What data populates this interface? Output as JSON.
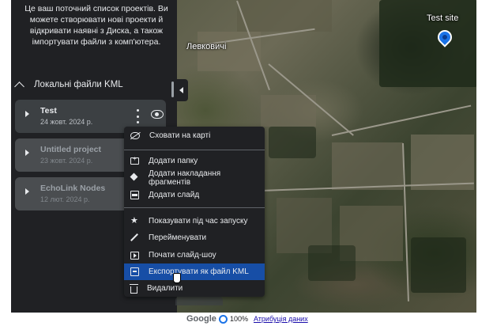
{
  "map": {
    "labels": {
      "village": "Левковичі",
      "site": "Test site"
    }
  },
  "panel": {
    "intro": "Це ваш поточний список проектів. Ви можете створювати нові проекти й відкривати наявні з Диска, а також імпортувати файли з комп'ютера.",
    "section_title": "Локальні файли KML",
    "projects": [
      {
        "name": "Test",
        "date": "24 жовт. 2024 р."
      },
      {
        "name": "Untitled project",
        "date": "23 жовт. 2024 р."
      },
      {
        "name": "EchoLink Nodes",
        "date": "12 лют. 2024 р."
      }
    ]
  },
  "context_menu": {
    "items": [
      {
        "label": "Сховати на карті",
        "icon": "eye-off-icon"
      },
      {
        "label": "Додати папку",
        "icon": "folder-add-icon"
      },
      {
        "label": "Додати накладання фрагментів",
        "icon": "layers-icon"
      },
      {
        "label": "Додати слайд",
        "icon": "slide-icon"
      },
      {
        "label": "Показувати під час запуску",
        "icon": "star-icon"
      },
      {
        "label": "Перейменувати",
        "icon": "pencil-icon"
      },
      {
        "label": "Почати слайд-шоу",
        "icon": "slideshow-icon"
      },
      {
        "label": "Експортувати як файл KML",
        "icon": "export-icon"
      },
      {
        "label": "Видалити",
        "icon": "trash-icon"
      }
    ],
    "selected": "Експортувати як файл KML",
    "selected_color": "#174ea6"
  },
  "bottom_bar": {
    "brand": "Google",
    "zoom": "100%",
    "attribution": "Атрибуція даних"
  },
  "colors": {
    "panel_bg": "#202124",
    "accent": "#1a73e8"
  }
}
